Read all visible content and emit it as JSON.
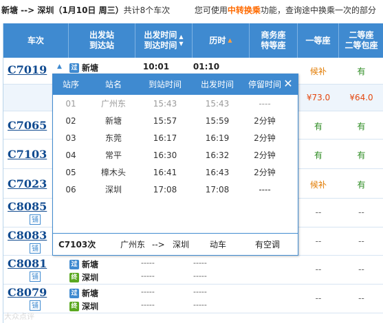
{
  "topbar": {
    "route": "新塘 --> 深圳（1月10日  周三）",
    "count": "共计8个车次",
    "hint_pre": "您可使用",
    "hint_link": "中转换乘",
    "hint_post": "功能，查询途中换乘一次的部分"
  },
  "header": {
    "train_no": "车次",
    "station_1": "出发站",
    "station_2": "到达站",
    "time_1": "出发时间",
    "time_2": "到达时间",
    "duration": "历时",
    "business_1": "商务座",
    "business_2": "特等座",
    "first": "一等座",
    "second_1": "二等座",
    "second_2": "二等包座"
  },
  "rows": [
    {
      "train": "C7019",
      "from": "新塘",
      "depart": "10:01",
      "duration": "01:10",
      "first": "候补",
      "second": "有"
    },
    {
      "price_first": "¥73.0",
      "price_second": "¥64.0"
    },
    {
      "train": "C7065",
      "first": "有",
      "second": "有"
    },
    {
      "train": "C7103",
      "first": "有",
      "second": "有"
    },
    {
      "train": "C7023",
      "first": "候补",
      "second": "有"
    },
    {
      "train": "C8085",
      "pu": "铺",
      "first": "--",
      "second": "--"
    },
    {
      "train": "C8083",
      "pu": "铺",
      "first": "--",
      "second": "--"
    },
    {
      "train": "C8081",
      "pu": "铺",
      "from": "新塘",
      "to": "深圳",
      "dash": "-----",
      "first": "--",
      "second": "--"
    },
    {
      "train": "C8079",
      "pu": "铺",
      "from": "新塘",
      "to": "深圳",
      "dash": "-----",
      "first": "--",
      "second": "--"
    }
  ],
  "badges": {
    "pass": "过",
    "end": "终"
  },
  "popup": {
    "headers": [
      "站序",
      "站名",
      "到站时间",
      "出发时间",
      "停留时间"
    ],
    "close": "✕",
    "stops": [
      {
        "seq": "01",
        "name": "广州东",
        "arrive": "15:43",
        "depart": "15:43",
        "stay": "----"
      },
      {
        "seq": "02",
        "name": "新塘",
        "arrive": "15:57",
        "depart": "15:59",
        "stay": "2分钟"
      },
      {
        "seq": "03",
        "name": "东莞",
        "arrive": "16:17",
        "depart": "16:19",
        "stay": "2分钟"
      },
      {
        "seq": "04",
        "name": "常平",
        "arrive": "16:30",
        "depart": "16:32",
        "stay": "2分钟"
      },
      {
        "seq": "05",
        "name": "樟木头",
        "arrive": "16:41",
        "depart": "16:43",
        "stay": "2分钟"
      },
      {
        "seq": "06",
        "name": "深圳",
        "arrive": "17:08",
        "depart": "17:08",
        "stay": "----"
      }
    ],
    "footer": {
      "train": "C7103次",
      "from": "广州东",
      "arrow": "-->",
      "to": "深圳",
      "type": "动车",
      "ac": "有空调"
    }
  },
  "watermark": "大众点评"
}
